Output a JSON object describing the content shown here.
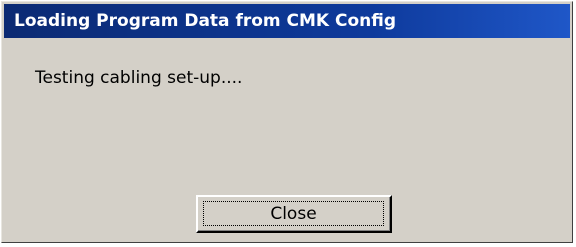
{
  "dialog": {
    "title": "Loading Program Data from CMK Config",
    "message": "Testing cabling set-up....",
    "close_label": "Close"
  }
}
